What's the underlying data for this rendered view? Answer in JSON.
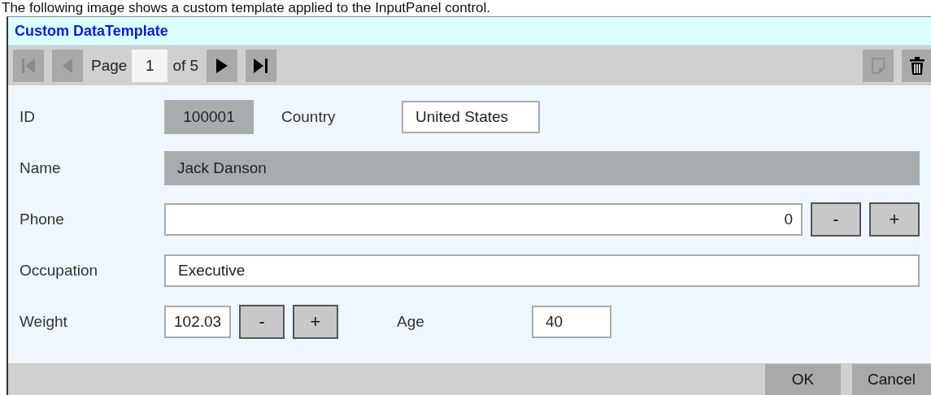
{
  "caption": "The following image shows a custom template applied to the InputPanel control.",
  "panel": {
    "title": "Custom DataTemplate",
    "navigator": {
      "buttons": [
        {
          "kind": "first",
          "disabled": true
        },
        {
          "kind": "previous",
          "disabled": true
        },
        {
          "kind": "page"
        },
        {
          "kind": "next",
          "disabled": false
        },
        {
          "kind": "last",
          "disabled": false
        }
      ],
      "page_label": "Page",
      "page": "1",
      "of_label": "of 5"
    },
    "actions": [
      {
        "kind": "add",
        "disabled": true
      },
      {
        "kind": "delete",
        "disabled": false
      }
    ],
    "rows": [
      {
        "items": [
          {
            "kind": "label",
            "text": "ID"
          },
          {
            "kind": "readonly",
            "value": "100001"
          },
          {
            "kind": "label",
            "text": "Country"
          },
          {
            "kind": "input",
            "value": "United States"
          }
        ]
      },
      {
        "items": [
          {
            "kind": "label",
            "text": "Name"
          },
          {
            "kind": "readonly",
            "value": "Jack Danson"
          }
        ]
      },
      {
        "items": [
          {
            "kind": "label",
            "text": "Phone"
          },
          {
            "kind": "spin",
            "value": "0",
            "minus": "-",
            "plus": "+"
          }
        ]
      },
      {
        "items": [
          {
            "kind": "label",
            "text": "Occupation"
          },
          {
            "kind": "input",
            "value": "Executive"
          }
        ]
      },
      {
        "items": [
          {
            "kind": "label",
            "text": "Weight"
          },
          {
            "kind": "spin",
            "value": "102.03",
            "minus": "-",
            "plus": "+"
          },
          {
            "kind": "label",
            "text": "Age"
          },
          {
            "kind": "input",
            "value": "40"
          }
        ]
      }
    ],
    "buttons": [
      {
        "label": "OK"
      },
      {
        "label": "Cancel"
      }
    ]
  }
}
